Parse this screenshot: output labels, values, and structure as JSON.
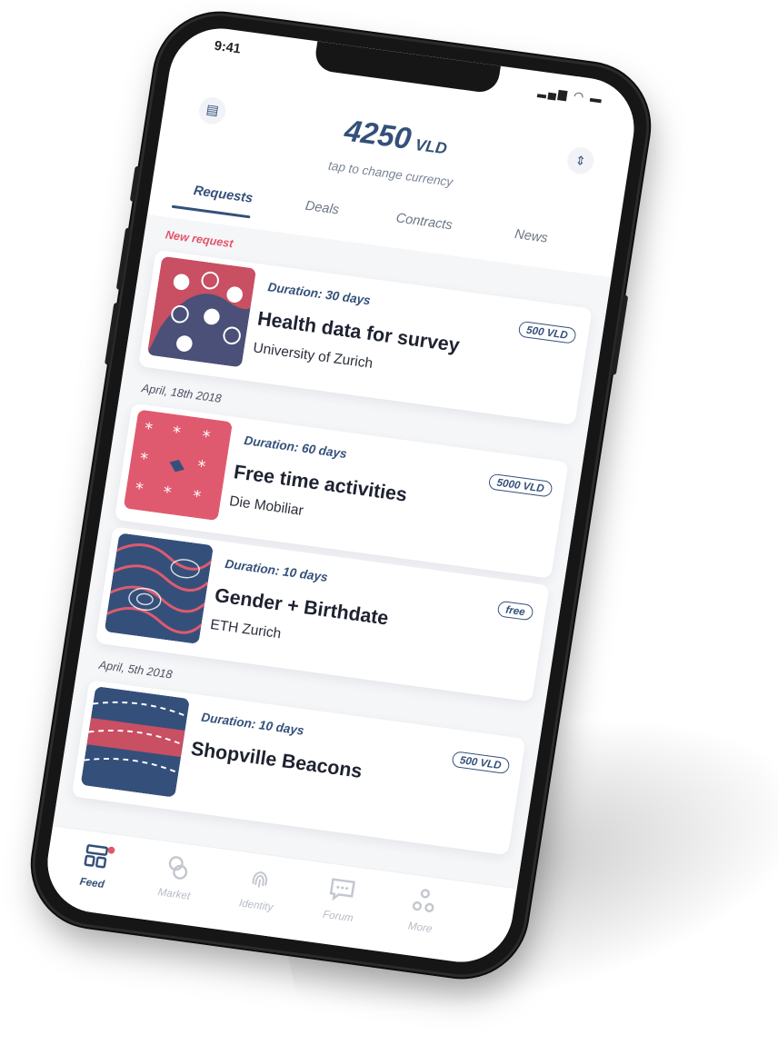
{
  "status": {
    "time": "9:41"
  },
  "balance": {
    "amount": "4250",
    "currency": "VLD",
    "hint": "tap to change currency"
  },
  "tabs": [
    {
      "label": "Requests",
      "active": true
    },
    {
      "label": "Deals"
    },
    {
      "label": "Contracts"
    },
    {
      "label": "News"
    }
  ],
  "feed": {
    "new_label": "New request",
    "sections": [
      {
        "date": "April, 18th 2018"
      },
      {
        "date": "April, 5th 2018"
      }
    ],
    "cards": [
      {
        "duration": "Duration: 30 days",
        "title": "Health data for survey",
        "org": "University of Zurich",
        "price": "500 VLD"
      },
      {
        "duration": "Duration: 60 days",
        "title": "Free time activities",
        "org": "Die Mobiliar",
        "price": "5000 VLD"
      },
      {
        "duration": "Duration: 10 days",
        "title": "Gender + Birthdate",
        "org": "ETH Zurich",
        "price": "free"
      },
      {
        "duration": "Duration: 10 days",
        "title": "Shopville Beacons",
        "org": "",
        "price": "500 VLD"
      }
    ]
  },
  "nav": [
    {
      "label": "Feed",
      "icon": "feed-icon",
      "active": true
    },
    {
      "label": "Market",
      "icon": "market-icon"
    },
    {
      "label": "Identity",
      "icon": "fingerprint-icon"
    },
    {
      "label": "Forum",
      "icon": "chat-icon"
    },
    {
      "label": "More",
      "icon": "more-icon"
    }
  ],
  "colors": {
    "primary": "#34507a",
    "accent": "#e2566b",
    "background": "#f5f6f8"
  }
}
